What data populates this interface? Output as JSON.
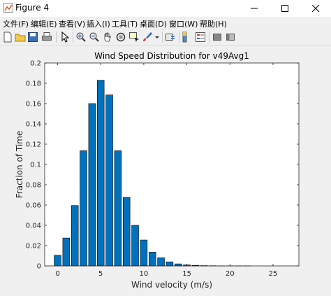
{
  "window": {
    "title": "Figure 4"
  },
  "menu": [
    "文件(F)",
    "编辑(E)",
    "查看(V)",
    "插入(I)",
    "工具(T)",
    "桌面(D)",
    "窗口(W)",
    "帮助(H)"
  ],
  "colors": {
    "bar": "#0072bd",
    "window_bg": "#f0f0f0",
    "axes_bg": "#ffffff"
  },
  "toolbar_icons": [
    "new-figure-icon",
    "open-file-icon",
    "save-icon",
    "print-icon",
    "pointer-icon",
    "zoom-in-icon",
    "zoom-out-icon",
    "pan-icon",
    "rotate-icon",
    "data-cursor-icon",
    "brush-icon",
    "link-plot-icon",
    "colorbar-icon",
    "legend-icon",
    "hide-plot-tools-icon",
    "show-plot-tools-icon"
  ],
  "chart_data": {
    "type": "bar",
    "title": "Wind Speed Distribution for v49Avg1",
    "xlabel": "Wind velocity (m/s)",
    "ylabel": "Fraction of Time",
    "xlim": [
      -1.5,
      28
    ],
    "ylim": [
      0,
      0.2
    ],
    "xticks": [
      "0",
      "5",
      "10",
      "15",
      "20",
      "25"
    ],
    "yticks": [
      "0",
      "0.02",
      "0.04",
      "0.06",
      "0.08",
      "0.1",
      "0.12",
      "0.14",
      "0.16",
      "0.18",
      "0.2"
    ],
    "x": [
      0,
      1,
      2,
      3,
      4,
      5,
      6,
      7,
      8,
      9,
      10,
      11,
      12,
      13,
      14,
      15,
      16,
      17,
      18,
      19,
      20,
      21,
      22,
      23,
      24,
      25,
      26
    ],
    "values": [
      0.0105,
      0.0275,
      0.0595,
      0.1135,
      0.16,
      0.183,
      0.1685,
      0.1135,
      0.0675,
      0.04,
      0.0255,
      0.0135,
      0.008,
      0.004,
      0.002,
      0.001,
      0.0005,
      0.0003,
      0.0002,
      0.0001,
      0.0001,
      0.0001,
      0.0001,
      0.0,
      0.0,
      0.0,
      0.0
    ]
  }
}
